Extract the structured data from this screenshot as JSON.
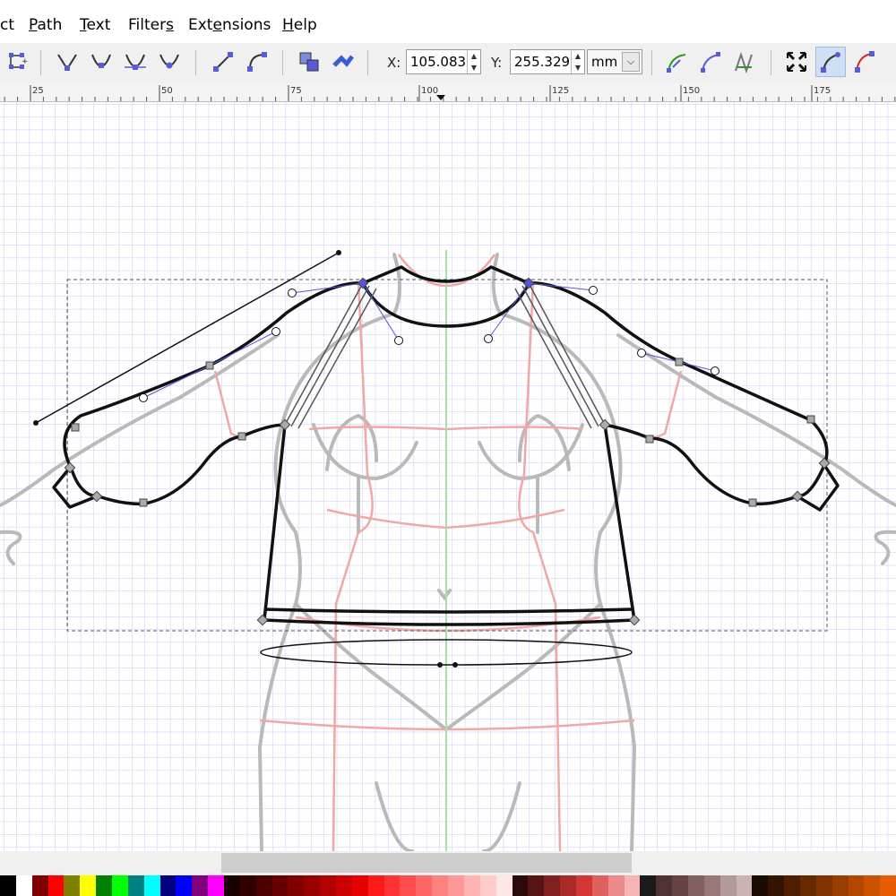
{
  "menu": [
    {
      "pre": "",
      "ul": "",
      "post": "ct"
    },
    {
      "pre": "",
      "ul": "P",
      "post": "ath"
    },
    {
      "pre": "",
      "ul": "T",
      "post": "ext"
    },
    {
      "pre": "Filter",
      "ul": "s",
      "post": ""
    },
    {
      "pre": "Ext",
      "ul": "e",
      "post": "nsions"
    },
    {
      "pre": "",
      "ul": "H",
      "post": "elp"
    }
  ],
  "toolbar": {
    "x_label": "X:",
    "x_value": "105.083",
    "y_label": "Y:",
    "y_value": "255.329",
    "unit": "mm",
    "icons": [
      "join-nodes-icon",
      "cusp-node-icon",
      "smooth-node-icon",
      "symmetric-node-icon",
      "auto-smooth-node-icon",
      "segment-line-icon",
      "segment-curve-icon",
      "object-to-path-icon",
      "stroke-to-path-icon",
      "show-clipping-path-icon",
      "show-mask-icon",
      "show-path-effects-icon",
      "show-transform-handles-icon",
      "show-bezier-handles-icon",
      "show-path-outline-icon"
    ]
  },
  "ruler": {
    "ticks": [
      "25",
      "50",
      "75",
      "100",
      "125",
      "150",
      "175"
    ]
  },
  "colors": {
    "grid": "#c8c8f0",
    "figure": "#b9b9b9",
    "guide_red": "#f2a6a6",
    "center_guide": "#a8e0a8",
    "path": "#111111",
    "handle": "#5555dd"
  },
  "palette": [
    "#000000",
    "#ffffff",
    "#800000",
    "#ff0000",
    "#808000",
    "#ffff00",
    "#008000",
    "#00ff00",
    "#008080",
    "#00ffff",
    "#000080",
    "#0000ff",
    "#800080",
    "#ff00ff",
    "#1a0000",
    "#330000",
    "#4d0000",
    "#660000",
    "#800000",
    "#990000",
    "#b30000",
    "#cc0000",
    "#e60000",
    "#ff1a1a",
    "#ff3333",
    "#ff4d4d",
    "#ff6666",
    "#ff8080",
    "#ff9999",
    "#ffb3b3",
    "#ffcccc",
    "#ffe6e6",
    "#2b0a0a",
    "#551515",
    "#802020",
    "#aa2a2a",
    "#d43535",
    "#e06060",
    "#ea8a8a",
    "#f5b5b5",
    "#1a1a1a",
    "#4d3333",
    "#664444",
    "#806060",
    "#997777",
    "#b39999",
    "#ccb3b3",
    "#1a0a00",
    "#331400",
    "#4d1f00",
    "#662900",
    "#803300",
    "#993d00",
    "#b34700",
    "#cc5200",
    "#e65c00"
  ]
}
